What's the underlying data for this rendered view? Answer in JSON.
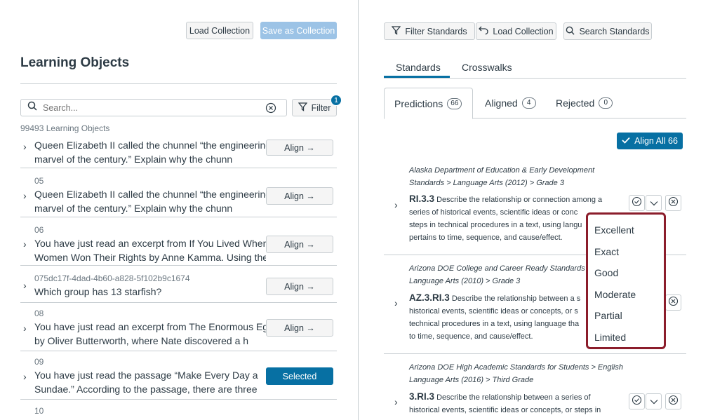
{
  "left": {
    "toolbar": {
      "load_collection": "Load Collection",
      "save_as_collection": "Save as Collection"
    },
    "title": "Learning Objects",
    "search": {
      "placeholder": "Search...",
      "value": ""
    },
    "filter": {
      "label": "Filter",
      "badge": "1"
    },
    "count_text": "99493 Learning Objects",
    "rows": [
      {
        "id": "",
        "line1": "Queen Elizabeth II called the chunnel “the engineering",
        "line2": "marvel of the century.” Explain why the chunn",
        "button": "Align →",
        "state": "default"
      },
      {
        "id": "05",
        "line1": "Queen Elizabeth II called the chunnel “the engineering",
        "line2": "marvel of the century.” Explain why the chunn",
        "button": "Align →",
        "state": "default"
      },
      {
        "id": "06",
        "line1": "You have just read an excerpt from If You Lived When",
        "line2": "Women Won Their Rights by Anne Kamma. Using the",
        "button": "Align →",
        "state": "default"
      },
      {
        "id": "075dc17f-4dad-4b60-a828-5f102b9c1674",
        "line1": "Which group has 13 starfish?",
        "line2": "",
        "button": "Align →",
        "state": "default"
      },
      {
        "id": "08",
        "line1": "You have just read an excerpt from The Enormous Egg",
        "line2": "by Oliver Butterworth, where Nate discovered a h",
        "button": "Align →",
        "state": "default"
      },
      {
        "id": "09",
        "line1": "You have just read the passage “Make Every Day a",
        "line2": "Sundae.” According to the passage, there are three",
        "button": "Selected",
        "state": "selected"
      },
      {
        "id": "10",
        "line1": "",
        "line2": "",
        "button": "",
        "state": "default"
      }
    ]
  },
  "right": {
    "toolbar": {
      "filter_standards": "Filter Standards",
      "load_collection": "Load Collection",
      "search_standards": "Search Standards"
    },
    "tabs": [
      {
        "label": "Standards",
        "active": true
      },
      {
        "label": "Crosswalks",
        "active": false
      }
    ],
    "subtabs": [
      {
        "label": "Predictions",
        "count": "66",
        "active": true
      },
      {
        "label": "Aligned",
        "count": "4",
        "active": false
      },
      {
        "label": "Rejected",
        "count": "0",
        "active": false
      }
    ],
    "align_all": "Align All 66",
    "standards": [
      {
        "source_line1": "Alaska Department of Education & Early Development",
        "source_line2": "Standards > Language Arts (2012) > Grade 3",
        "code": "RI.3.3",
        "text_line1": " Describe the relationship or connection among a",
        "text_line2": "series of historical events, scientific ideas or conc",
        "text_line3": "steps in technical procedures in a text, using langu",
        "text_line4": "pertains to time, sequence, and cause/effect."
      },
      {
        "source_line1": "Arizona DOE College and Career Ready Standards >",
        "source_line2": "Language Arts (2010) > Grade 3",
        "code": "AZ.3.RI.3",
        "text_line1": " Describe the relationship between a s",
        "text_line2": "historical events, scientific ideas or concepts, or s",
        "text_line3": "technical procedures in a text, using language tha",
        "text_line4": "to time, sequence, and cause/effect."
      },
      {
        "source_line1": "Arizona DOE High Academic Standards for Students > English",
        "source_line2": "Language Arts (2016) > Third Grade",
        "code": "3.RI.3",
        "text_line1": " Describe the relationship between a series of",
        "text_line2": "historical events, scientific ideas or concepts, or steps in",
        "text_line3": "",
        "text_line4": ""
      }
    ],
    "match_menu": [
      "Excellent",
      "Exact",
      "Good",
      "Moderate",
      "Partial",
      "Limited"
    ]
  },
  "colors": {
    "accent": "#0770a3",
    "accent_disabled": "#9cc3e6",
    "menu_highlight_border": "#8b1d2b",
    "text": "#2d3b45",
    "muted": "#6b7780",
    "divider": "#c7cdd1"
  }
}
